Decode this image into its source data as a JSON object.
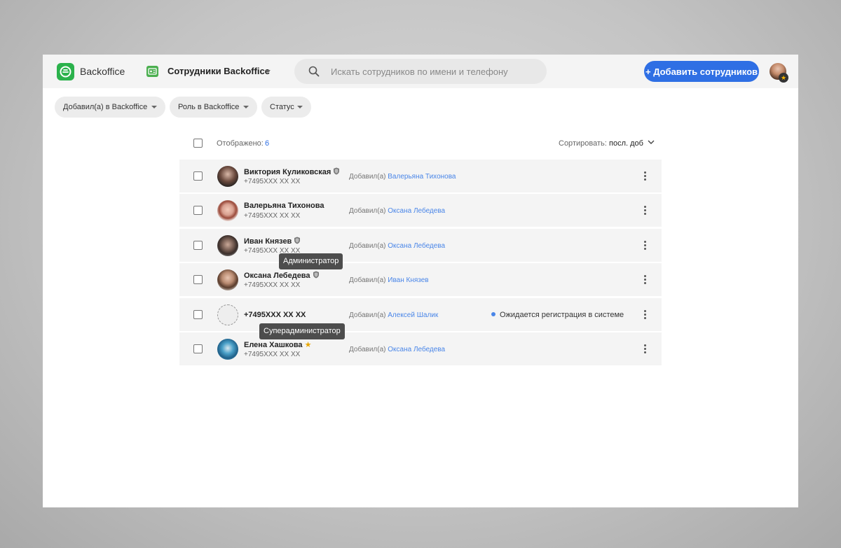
{
  "app": {
    "brand": "Backoffice",
    "section_title": "Сотрудники Backoffice",
    "search_placeholder": "Искать сотрудников по имени и телефону",
    "add_button": "+ Добавить сотрудников",
    "colors": {
      "accent": "#2f6fe4",
      "logo": "#2bb24c",
      "link": "#4a86e8",
      "row_bg": "#f4f4f4"
    }
  },
  "filters": [
    {
      "label": "Добавил(а) в Backoffice"
    },
    {
      "label": "Роль в Backoffice"
    },
    {
      "label": "Статус"
    }
  ],
  "list": {
    "shown_label": "Отображено:",
    "shown_count": "6",
    "sort_label": "Сортировать:",
    "sort_value": "посл. доб"
  },
  "added_prefix": "Добавил(а)",
  "rows": [
    {
      "name": "Виктория Куликовская",
      "phone": "+7495XXX XX XX",
      "added_by": "Валерьяна Тихонова",
      "role": "admin"
    },
    {
      "name": "Валерьяна Тихонова",
      "phone": "+7495XXX XX XX",
      "added_by": "Оксана Лебедева",
      "role": "none"
    },
    {
      "name": "Иван Князев",
      "phone": "+7495XXX XX XX",
      "added_by": "Оксана Лебедева",
      "role": "admin"
    },
    {
      "name": "Оксана Лебедева",
      "phone": "+7495XXX XX XX",
      "added_by": "Иван Князев",
      "role": "admin"
    },
    {
      "name": "+7495XXX XX XX",
      "phone": "",
      "added_by": "Алексей Шалик",
      "role": "none",
      "status": "Ожидается регистрация в системе"
    },
    {
      "name": "Елена Хашкова",
      "phone": "+7495XXX XX XX",
      "added_by": "Оксана Лебедева",
      "role": "superadmin"
    }
  ],
  "tooltips": {
    "admin": "Администратор",
    "superadmin": "Суперадминистратор"
  }
}
